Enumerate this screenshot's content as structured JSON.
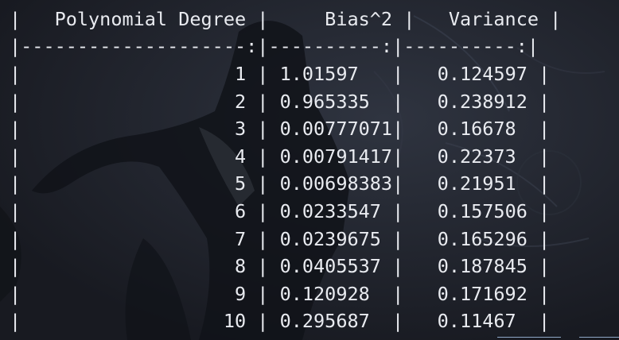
{
  "table": {
    "header": {
      "degree": "Polynomial Degree",
      "bias": "Bias^2",
      "variance": "Variance"
    },
    "separator": {
      "degree": "--------------------:",
      "bias": "----------:",
      "variance": "----------:"
    },
    "rows": [
      {
        "degree": "1",
        "bias": "1.01597",
        "variance": "0.124597"
      },
      {
        "degree": "2",
        "bias": "0.965335",
        "variance": "0.238912"
      },
      {
        "degree": "3",
        "bias": "0.00777071",
        "variance": "0.16678"
      },
      {
        "degree": "4",
        "bias": "0.00791417",
        "variance": "0.22373"
      },
      {
        "degree": "5",
        "bias": "0.00698383",
        "variance": "0.21951"
      },
      {
        "degree": "6",
        "bias": "0.0233547",
        "variance": "0.157506"
      },
      {
        "degree": "7",
        "bias": "0.0239675",
        "variance": "0.165296"
      },
      {
        "degree": "8",
        "bias": "0.0405537",
        "variance": "0.187845"
      },
      {
        "degree": "9",
        "bias": "0.120928",
        "variance": "0.171692"
      },
      {
        "degree": "10",
        "bias": "0.295687",
        "variance": "0.11467"
      }
    ]
  },
  "colors": {
    "text": "#e9ebf0",
    "background": "#1d2028"
  }
}
